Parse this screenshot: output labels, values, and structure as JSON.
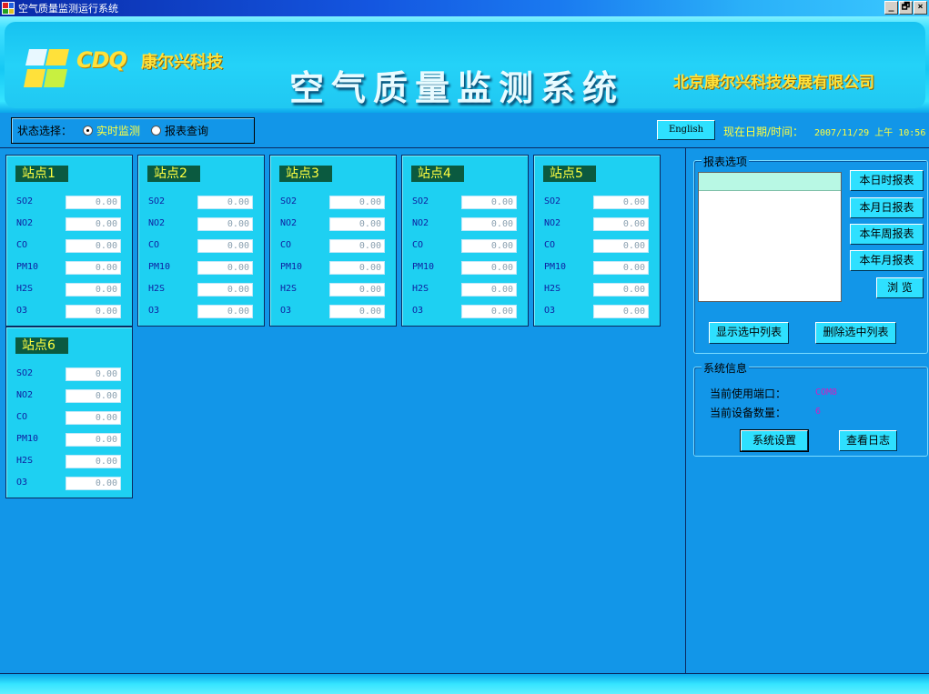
{
  "window": {
    "title": "空气质量监测运行系统",
    "controls": [
      "_",
      "🗗",
      "×"
    ]
  },
  "banner": {
    "logo_text": "CDQ",
    "logo_company": "康尔兴科技",
    "main_title": "空气质量监测系统",
    "company_right": "北京康尔兴科技发展有限公司"
  },
  "toolbar": {
    "status_label": "状态选择：",
    "mode_realtime": "实时监测",
    "mode_report": "报表查询",
    "selected_mode": "realtime",
    "english_button": "English",
    "datetime_label": "现在日期/时间：",
    "datetime_value": "2007/11/29 上午 10:56"
  },
  "stations": [
    {
      "name": "站点1",
      "readings": [
        [
          "SO2",
          "0.00"
        ],
        [
          "NO2",
          "0.00"
        ],
        [
          "CO",
          "0.00"
        ],
        [
          "PM10",
          "0.00"
        ],
        [
          "H2S",
          "0.00"
        ],
        [
          "O3",
          "0.00"
        ]
      ]
    },
    {
      "name": "站点2",
      "readings": [
        [
          "SO2",
          "0.00"
        ],
        [
          "NO2",
          "0.00"
        ],
        [
          "CO",
          "0.00"
        ],
        [
          "PM10",
          "0.00"
        ],
        [
          "H2S",
          "0.00"
        ],
        [
          "O3",
          "0.00"
        ]
      ]
    },
    {
      "name": "站点3",
      "readings": [
        [
          "SO2",
          "0.00"
        ],
        [
          "NO2",
          "0.00"
        ],
        [
          "CO",
          "0.00"
        ],
        [
          "PM10",
          "0.00"
        ],
        [
          "H2S",
          "0.00"
        ],
        [
          "O3",
          "0.00"
        ]
      ]
    },
    {
      "name": "站点4",
      "readings": [
        [
          "SO2",
          "0.00"
        ],
        [
          "NO2",
          "0.00"
        ],
        [
          "CO",
          "0.00"
        ],
        [
          "PM10",
          "0.00"
        ],
        [
          "H2S",
          "0.00"
        ],
        [
          "O3",
          "0.00"
        ]
      ]
    },
    {
      "name": "站点5",
      "readings": [
        [
          "SO2",
          "0.00"
        ],
        [
          "NO2",
          "0.00"
        ],
        [
          "CO",
          "0.00"
        ],
        [
          "PM10",
          "0.00"
        ],
        [
          "H2S",
          "0.00"
        ],
        [
          "O3",
          "0.00"
        ]
      ]
    },
    {
      "name": "站点6",
      "readings": [
        [
          "SO2",
          "0.00"
        ],
        [
          "NO2",
          "0.00"
        ],
        [
          "CO",
          "0.00"
        ],
        [
          "PM10",
          "0.00"
        ],
        [
          "H2S",
          "0.00"
        ],
        [
          "O3",
          "0.00"
        ]
      ]
    }
  ],
  "report": {
    "group_title": "报表选项",
    "buttons": [
      "本日时报表",
      "本月日报表",
      "本年周报表",
      "本年月报表",
      "浏 览"
    ],
    "show_selected": "显示选中列表",
    "delete_selected": "删除选中列表"
  },
  "system": {
    "group_title": "系统信息",
    "port_label": "当前使用端口：",
    "port_value": "COM8",
    "device_count_label": "当前设备数量：",
    "device_count_value": "6",
    "settings_button": "系统设置",
    "log_button": "查看日志"
  },
  "colors": {
    "panel_bg": "#1296e8",
    "station_bg": "#1ed0f2",
    "station_name_bg": "#0b5a40",
    "accent_yellow": "#ffff40",
    "button_bg": "#2ee0ff"
  }
}
